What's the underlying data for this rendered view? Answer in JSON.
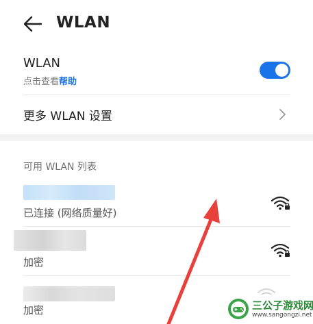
{
  "header": {
    "title": "WLAN",
    "back_icon": "back-arrow-icon"
  },
  "wlan_toggle": {
    "label": "WLAN",
    "subtitle_prefix": "点击查看",
    "subtitle_link": "帮助",
    "state": "on",
    "accent_color": "#1a73e8"
  },
  "more_settings": {
    "label": "更多 WLAN 设置",
    "icon": "chevron-right-icon"
  },
  "network_list": {
    "header": "可用 WLAN 列表",
    "items": [
      {
        "ssid": "",
        "status": "已连接 (网络质量好)",
        "icon": "wifi-locked-icon"
      },
      {
        "ssid": "",
        "status": "加密",
        "icon": "wifi-locked-icon"
      },
      {
        "ssid": "",
        "status": "加密",
        "icon": "wifi-locked-icon"
      }
    ]
  },
  "watermark": {
    "title": "三公子游戏网",
    "url": "www.sangongzi.net"
  },
  "annotation": {
    "icon": "red-arrow-annotation",
    "color": "#e8403a"
  }
}
